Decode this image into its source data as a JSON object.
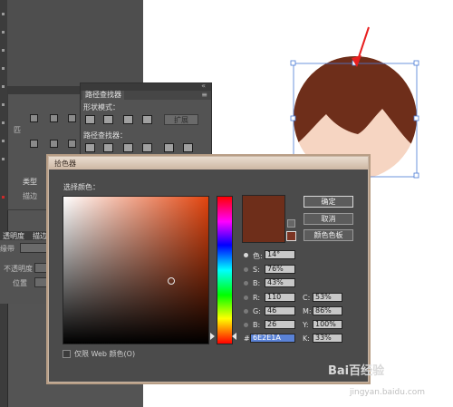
{
  "left_panel": {
    "row_label": "匹"
  },
  "pathfinder": {
    "tab_label": "路径查找器",
    "shape_modes_label": "形状模式：",
    "expand_label": "扩展",
    "pathfinders_label": "路径查找器："
  },
  "appearance_panel": {
    "type_label": "类型",
    "stroke_label": "描边"
  },
  "transparency_panel": {
    "tab_label": "透明度",
    "stroke_label": "描边",
    "mode_label": "缘带",
    "opacity_label": "不透明度",
    "position_label": "位置"
  },
  "color_picker": {
    "title": "拾色器",
    "select_color_label": "选择颜色：",
    "ok_label": "确定",
    "cancel_label": "取消",
    "swatches_label": "颜色色板",
    "web_only_label": "仅限 Web 颜色(O)",
    "current_color": "#6E2E1A",
    "hsb": [
      {
        "label": "色:",
        "value": "14°",
        "selected": true
      },
      {
        "label": "S:",
        "value": "76%",
        "selected": false
      },
      {
        "label": "B:",
        "value": "43%",
        "selected": false
      }
    ],
    "rgb": [
      {
        "label": "R:",
        "value": "110"
      },
      {
        "label": "G:",
        "value": "46"
      },
      {
        "label": "B:",
        "value": "26"
      }
    ],
    "cmyk": [
      {
        "label": "C:",
        "value": "53%"
      },
      {
        "label": "M:",
        "value": "86%"
      },
      {
        "label": "Y:",
        "value": "100%"
      },
      {
        "label": "K:",
        "value": "33%"
      }
    ],
    "hex_label": "#",
    "hex_value": "6E2E1A"
  },
  "illustration": {
    "hair_color": "#6e2e1a",
    "skin_color": "#f6d5c2",
    "arrow_color": "#e81f1f",
    "selection_color": "#4a7bd6"
  },
  "watermark": {
    "brand": "Bai百经验",
    "url": "jingyan.baidu.com"
  }
}
